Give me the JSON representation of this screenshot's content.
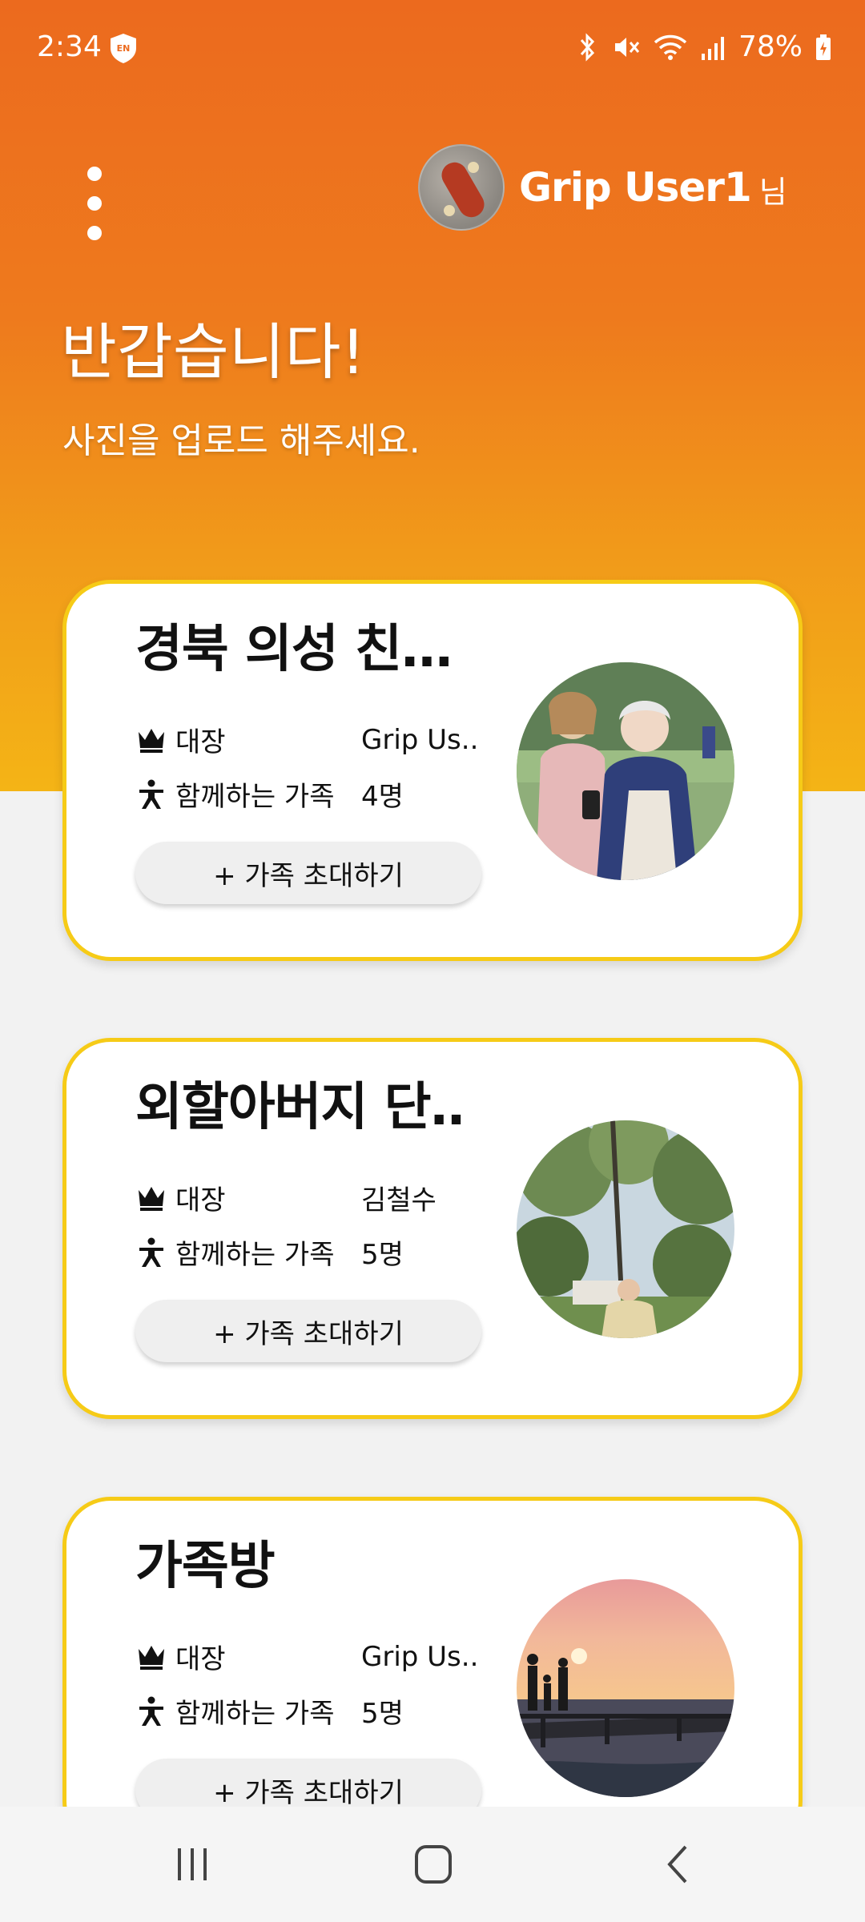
{
  "status_bar": {
    "time": "2:34",
    "shield_badge": "EN",
    "battery": "78%",
    "icons": [
      "bluetooth-icon",
      "mute-icon",
      "wifi-icon",
      "signal-icon",
      "battery-charging-icon"
    ]
  },
  "header": {
    "menu_icon": "more-vertical-icon",
    "user_name": "Grip User1",
    "user_suffix": "님",
    "greeting": "반갑습니다!",
    "subtitle": "사진을 업로드 해주세요."
  },
  "colors": {
    "gradient_top": "#ec6a1e",
    "gradient_bottom": "#f4b416",
    "card_border": "#f6cb17"
  },
  "rooms": [
    {
      "title": "경북 의성 친…",
      "leader_label": "대장",
      "leader_value": "Grip Us..",
      "members_label": "함께하는 가족",
      "members_value": "4명",
      "invite_label": "+ 가족 초대하기"
    },
    {
      "title": "외할아버지 단‥",
      "leader_label": "대장",
      "leader_value": "김철수",
      "members_label": "함께하는 가족",
      "members_value": "5명",
      "invite_label": "+ 가족 초대하기"
    },
    {
      "title": "가족방",
      "leader_label": "대장",
      "leader_value": "Grip Us..",
      "members_label": "함께하는 가족",
      "members_value": "5명",
      "invite_label": "+ 가족 초대하기"
    }
  ],
  "nav": {
    "icons": [
      "recent-apps-icon",
      "home-icon",
      "back-icon"
    ]
  }
}
